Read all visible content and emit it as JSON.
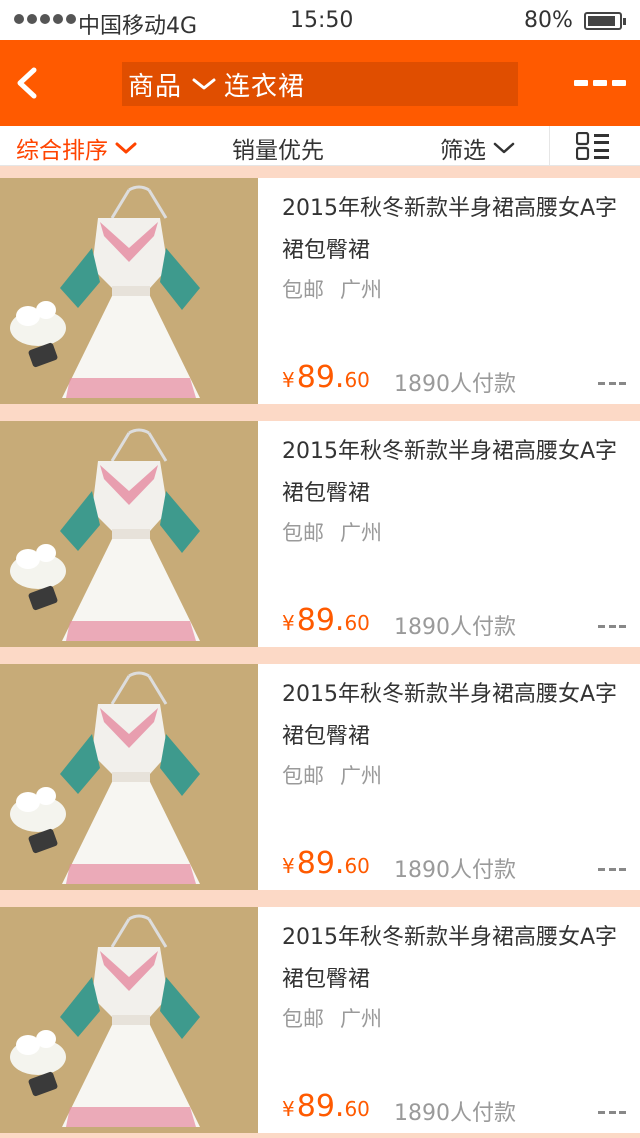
{
  "status_bar": {
    "carrier": "中国移动4G",
    "time": "15:50",
    "battery": "80%"
  },
  "nav": {
    "category": "商品",
    "query": "连衣裙",
    "accent_color": "#ff5a00",
    "back_icon": "chevron-left-icon",
    "menu_icon": "more-dashes-icon"
  },
  "sort_bar": {
    "comprehensive": "综合排序",
    "sales_first": "销量优先",
    "filter": "筛选",
    "active_color": "#ff4400",
    "layout_icon": "list-grid-toggle-icon"
  },
  "products": [
    {
      "title": "2015年秋冬新款半身裙高腰女A字裙包臀裙",
      "shipping": "包邮",
      "location": "广州",
      "price_symbol": "¥",
      "price_int": "89.",
      "price_dec": "60",
      "sales": "1890人付款"
    },
    {
      "title": "2015年秋冬新款半身裙高腰女A字裙包臀裙",
      "shipping": "包邮",
      "location": "广州",
      "price_symbol": "¥",
      "price_int": "89.",
      "price_dec": "60",
      "sales": "1890人付款"
    },
    {
      "title": "2015年秋冬新款半身裙高腰女A字裙包臀裙",
      "shipping": "包邮",
      "location": "广州",
      "price_symbol": "¥",
      "price_int": "89.",
      "price_dec": "60",
      "sales": "1890人付款"
    },
    {
      "title": "2015年秋冬新款半身裙高腰女A字裙包臀裙",
      "shipping": "包邮",
      "location": "广州",
      "price_symbol": "¥",
      "price_int": "89.",
      "price_dec": "60",
      "sales": "1890人付款"
    }
  ]
}
